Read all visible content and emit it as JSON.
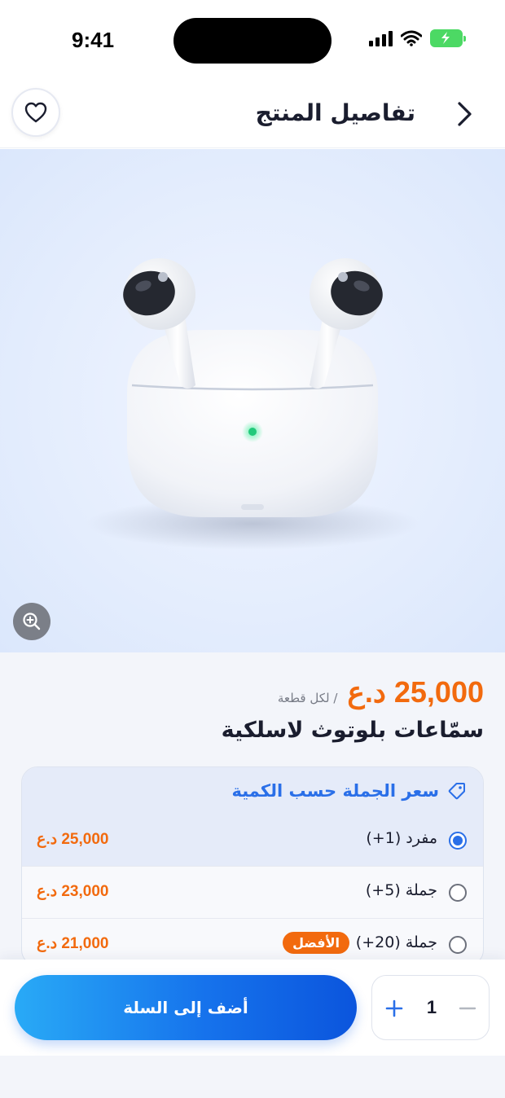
{
  "status_bar": {
    "time": "9:41"
  },
  "header": {
    "title": "تفاصيل المنتج"
  },
  "product": {
    "price": "25,000 د.ع",
    "per_unit": "/ لكل قطعة",
    "name": "سمّاعات بلوتوث لاسلكية"
  },
  "wholesale": {
    "title": "سعر الجملة حسب الكمية",
    "tiers": [
      {
        "label": "مفرد (1+)",
        "price": "25,000 د.ع",
        "selected": true
      },
      {
        "label": "جملة (5+)",
        "price": "23,000 د.ع",
        "selected": false
      },
      {
        "label": "جملة (20+)",
        "price": "21,000 د.ع",
        "selected": false,
        "badge": "الأفضل"
      }
    ]
  },
  "cart": {
    "add_label": "أضف إلى السلة",
    "quantity": "1"
  },
  "colors": {
    "accent": "#2a6fe8",
    "price": "#f26a0e",
    "badge": "#f26a0e",
    "battery": "#4cd964"
  },
  "icons": [
    "back-chevron-icon",
    "heart-icon",
    "zoom-in-icon",
    "tag-icon",
    "plus-icon",
    "minus-icon",
    "signal-icon",
    "wifi-icon",
    "battery-icon"
  ]
}
